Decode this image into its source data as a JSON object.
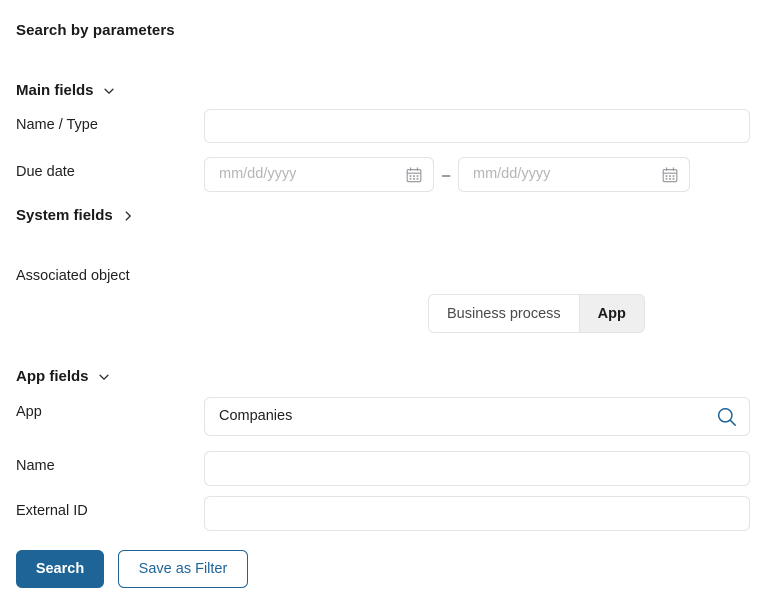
{
  "panel": {
    "title": "Search by parameters"
  },
  "sections": {
    "main_fields": {
      "label": "Main fields",
      "chevron": "chevron-down-icon",
      "expanded": true
    },
    "system_fields": {
      "label": "System fields",
      "chevron": "chevron-right-icon",
      "expanded": false
    },
    "app_fields": {
      "label": "App fields",
      "chevron": "chevron-down-icon",
      "expanded": true
    }
  },
  "main_fields": {
    "name_type": {
      "label": "Name / Type",
      "value": "",
      "placeholder": ""
    },
    "due_date": {
      "label": "Due date",
      "separator": "–",
      "from": {
        "value": "",
        "placeholder": "mm/dd/yyyy",
        "icon": "calendar-icon"
      },
      "to": {
        "value": "",
        "placeholder": "mm/dd/yyyy",
        "icon": "calendar-icon"
      }
    }
  },
  "associated_object": {
    "label": "Associated object",
    "options": [
      {
        "label": "Business process",
        "selected": false
      },
      {
        "label": "App",
        "selected": true
      }
    ],
    "selected_value": "App"
  },
  "app_fields": {
    "app": {
      "label": "App",
      "value": "Companies",
      "placeholder": "",
      "icon": "search-icon"
    },
    "name": {
      "label": "Name",
      "value": "",
      "placeholder": ""
    },
    "external_id": {
      "label": "External ID",
      "value": "",
      "placeholder": ""
    }
  },
  "actions": {
    "search": "Search",
    "save_as_filter": "Save as Filter"
  },
  "colors": {
    "accent": "#1f6497",
    "border": "#e3e4e6",
    "segment_active_bg": "#efefef",
    "placeholder": "#b3b5b8",
    "text": "#1a1a1a"
  }
}
